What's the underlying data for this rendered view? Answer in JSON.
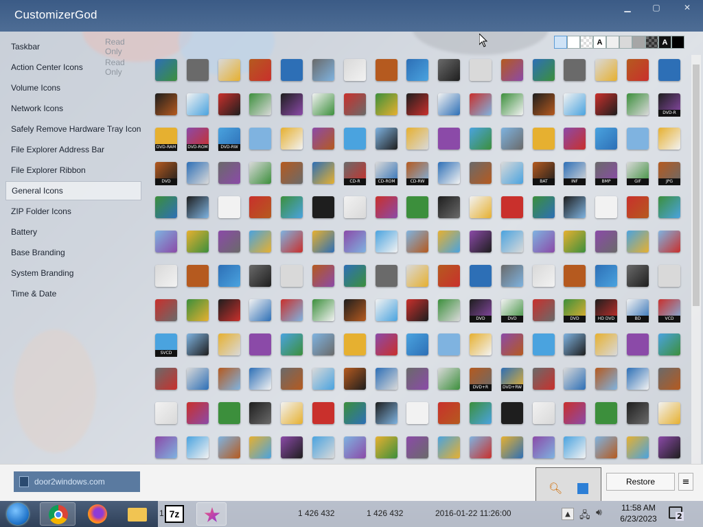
{
  "window": {
    "title": "CustomizerGod"
  },
  "sidebar": {
    "items": [
      {
        "label": "Taskbar",
        "badge": "Read Only"
      },
      {
        "label": "Action Center Icons",
        "badge": "Read Only"
      },
      {
        "label": "Volume Icons",
        "badge": ""
      },
      {
        "label": "Network Icons",
        "badge": ""
      },
      {
        "label": "Safely Remove Hardware Tray Icon",
        "badge": ""
      },
      {
        "label": "File Explorer Address Bar",
        "badge": ""
      },
      {
        "label": "File Explorer Ribbon",
        "badge": ""
      },
      {
        "label": "General Icons",
        "badge": ""
      },
      {
        "label": "ZIP Folder Icons",
        "badge": ""
      },
      {
        "label": "Battery",
        "badge": ""
      },
      {
        "label": "Base Branding",
        "badge": ""
      },
      {
        "label": "System Branding",
        "badge": ""
      },
      {
        "label": "Time & Date",
        "badge": ""
      }
    ],
    "active_index": 7
  },
  "swatches": [
    "",
    "",
    "",
    "A",
    "",
    "",
    "",
    "",
    "A",
    ""
  ],
  "icon_captions": {
    "r2": [
      "DVD-R"
    ],
    "r3": [
      "DVD-RAM",
      "DVD-ROM",
      "DVD-RW"
    ],
    "r4": [
      "DVD",
      "CD-R",
      "CD-ROM",
      "CD-RW",
      "BAT",
      "INF",
      "BMP",
      "GIF",
      "JPG"
    ],
    "r8": [
      "DVD",
      "DVD",
      "DVD",
      "HD DVD",
      "BD",
      "VCD"
    ],
    "r9": [
      "SVCD"
    ],
    "r10": [
      "DVD+R",
      "DVD+RW"
    ]
  },
  "bottom": {
    "brand": "door2windows.com",
    "restore_label": "Restore"
  },
  "taskbar": {
    "status_items": [
      "1 / 2",
      "1 426 432",
      "1 426 432",
      "2016-01-22 11:26:00"
    ],
    "time": "11:58 AM",
    "date": "6/23/2023",
    "notification_count": "2"
  },
  "colors": {
    "titlebar": "#3b5b86",
    "accent": "#5a7aa0",
    "error_red": "#e02020"
  }
}
